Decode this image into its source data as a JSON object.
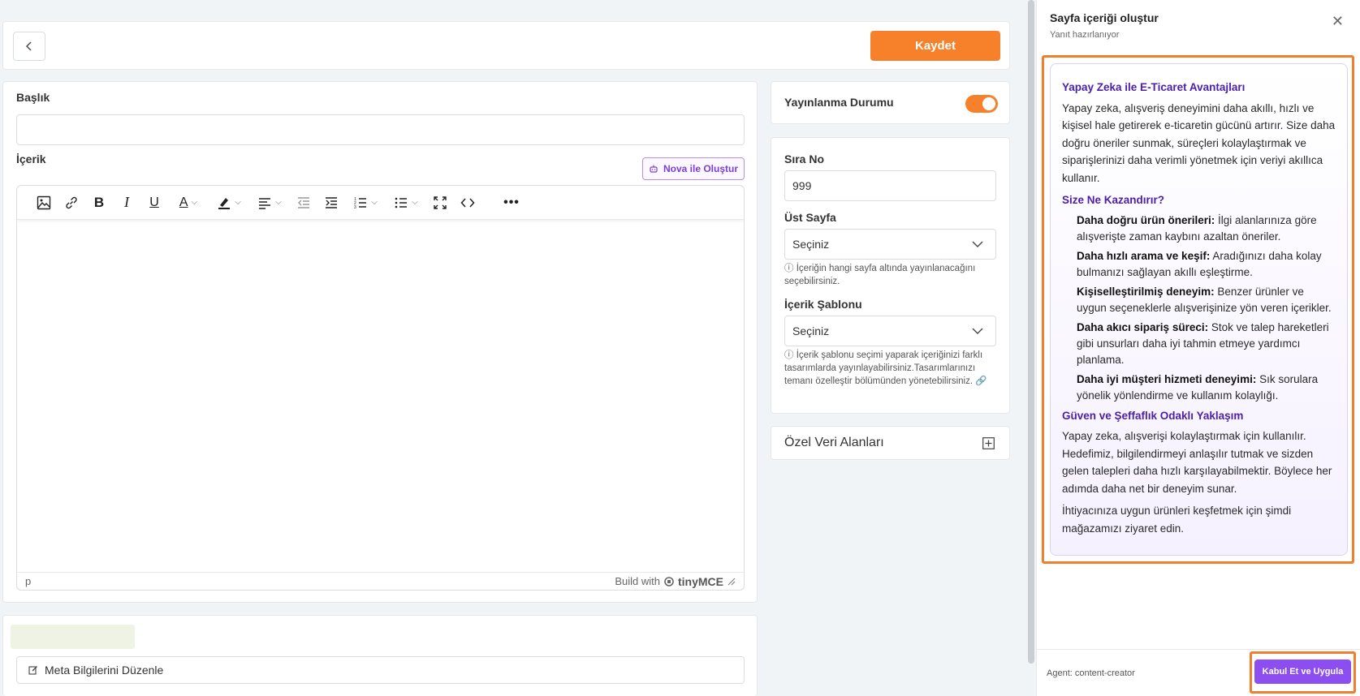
{
  "topbar": {
    "save_label": "Kaydet"
  },
  "main": {
    "title_label": "Başlık",
    "title_value": "",
    "content_label": "İçerik",
    "nova_button": "Nova ile Oluştur",
    "editor_status_element": "p",
    "editor_brand_prefix": "Build with",
    "editor_brand": "tinyMCE"
  },
  "meta": {
    "edit_button": "Meta Bilgilerini Düzenle"
  },
  "publish": {
    "label": "Yayınlanma Durumu",
    "enabled": true
  },
  "settings": {
    "order_label": "Sıra No",
    "order_value": "999",
    "parent_label": "Üst Sayfa",
    "parent_value": "Seçiniz",
    "parent_hint": "İçeriğin hangi sayfa altında yayınlanacağını seçebilirsiniz.",
    "template_label": "İçerik Şablonu",
    "template_value": "Seçiniz",
    "template_hint": "İçerik şablonu seçimi yaparak içeriğinizi farklı tasarımlarda yayınlayabilirsiniz.Tasarımlarınızı temanı özelleştir bölümünden yönetebilirsiniz."
  },
  "custom_fields": {
    "label": "Özel Veri Alanları"
  },
  "ai_panel": {
    "title": "Sayfa içeriği oluştur",
    "subtitle": "Yanıt hazırlanıyor",
    "heading1": "Yapay Zeka ile E-Ticaret Avantajları",
    "para1": "Yapay zeka, alışveriş deneyimini daha akıllı, hızlı ve kişisel hale getirerek e-ticaretin gücünü artırır. Size daha doğru öneriler sunmak, süreçleri kolaylaştırmak ve siparişlerinizi daha verimli yönetmek için veriyi akıllıca kullanır.",
    "heading2": "Size Ne Kazandırır?",
    "benefits": [
      {
        "title": "Daha doğru ürün önerileri:",
        "text": " İlgi alanlarınıza göre alışverişte zaman kaybını azaltan öneriler."
      },
      {
        "title": "Daha hızlı arama ve keşif:",
        "text": " Aradığınızı daha kolay bulmanızı sağlayan akıllı eşleştirme."
      },
      {
        "title": "Kişiselleştirilmiş deneyim:",
        "text": " Benzer ürünler ve uygun seçeneklerle alışverişinize yön veren içerikler."
      },
      {
        "title": "Daha akıcı sipariş süreci:",
        "text": " Stok ve talep hareketleri gibi unsurları daha iyi tahmin etmeye yardımcı planlama."
      },
      {
        "title": "Daha iyi müşteri hizmeti deneyimi:",
        "text": " Sık sorulara yönelik yönlendirme ve kullanım kolaylığı."
      }
    ],
    "heading3": "Güven ve Şeffaflık Odaklı Yaklaşım",
    "para2": "Yapay zeka, alışverişi kolaylaştırmak için kullanılır. Hedefimiz, bilgilendirmeyi anlaşılır tutmak ve sizden gelen talepleri daha hızlı karşılayabilmektir. Böylece her adımda daha net bir deneyim sunar.",
    "para3": "İhtiyacınıza uygun ürünleri keşfetmek için şimdi mağazamızı ziyaret edin.",
    "agent_label": "Agent: content-creator",
    "accept_button": "Kabul Et ve Uygula"
  },
  "colors": {
    "accent_orange": "#f7812a",
    "accent_purple": "#8c4ef0",
    "heading_purple": "#4b1fa8"
  }
}
